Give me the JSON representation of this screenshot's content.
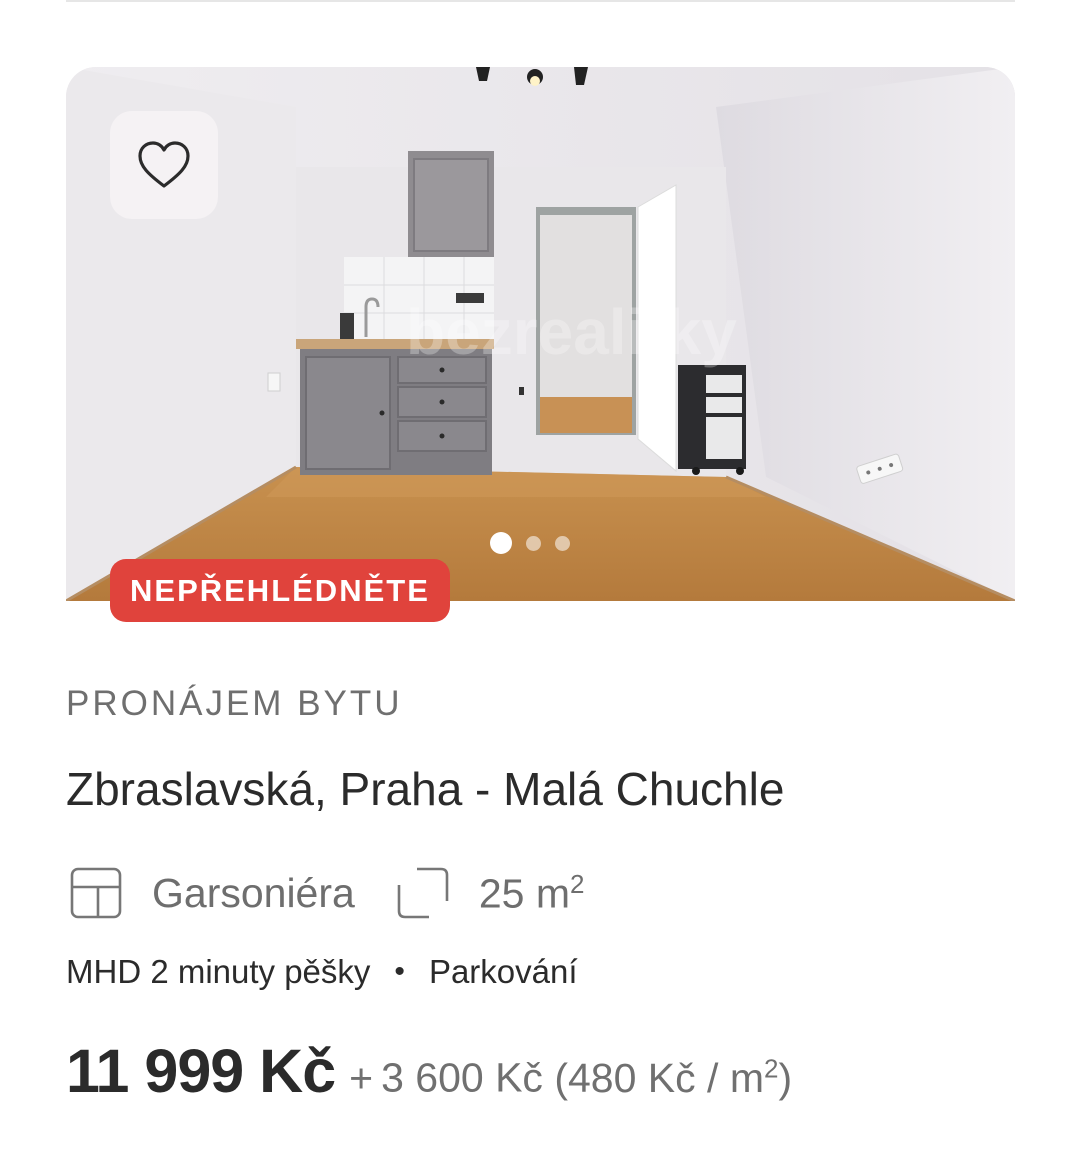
{
  "listing": {
    "favorite_icon": "heart-outline-icon",
    "gallery": {
      "photo_count": 3,
      "active_index": 0
    },
    "badge": "NEPŘEHLÉDNĚTE",
    "category": "PRONÁJEM BYTU",
    "address": "Zbraslavská, Praha - Malá Chuchle",
    "params": {
      "layout": {
        "icon": "floorplan-icon",
        "label": "Garsoniéra"
      },
      "area": {
        "icon": "area-corners-icon",
        "value": "25 m",
        "unit_sup": "2"
      }
    },
    "features": [
      "MHD 2 minuty pěšky",
      "Parkování"
    ],
    "feature_separator": "•",
    "price": {
      "main": "11 999 Kč",
      "plus": "+",
      "fees": "3 600 Kč",
      "per_m2": "(480 Kč / m",
      "per_m2_sup": "2",
      "per_m2_close": ")"
    },
    "watermark": "bezrealitky",
    "colors": {
      "badge": "#e0433c",
      "text": "#2b2b2b",
      "muted": "#6f6f6f"
    }
  }
}
